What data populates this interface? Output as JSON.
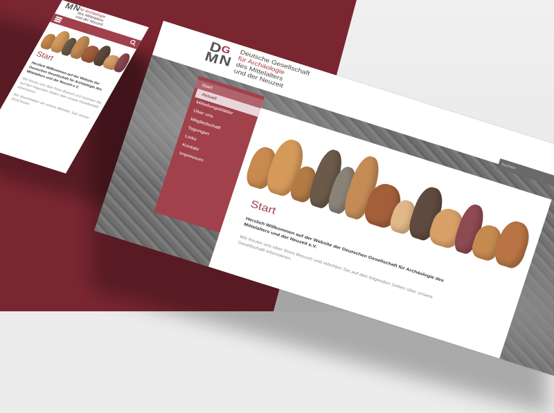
{
  "colors": {
    "brand": "#a0414c",
    "brand_dark": "#7a2631",
    "search_button": "#e6cfae"
  },
  "site": {
    "logo_letters": [
      "D",
      "G",
      "M",
      "N"
    ],
    "logo_lines": [
      "Deutsche Gesellschaft",
      "für Archäologie",
      "des Mittelalters",
      "und der Neuzeit"
    ]
  },
  "nav": {
    "items": [
      {
        "label": "Start",
        "active": true
      },
      {
        "label": "Aktuell",
        "sub": true
      },
      {
        "label": "Mitteilungsblätter"
      },
      {
        "label": "Über uns"
      },
      {
        "label": "Mitgliedschaft"
      },
      {
        "label": "Tagungen"
      },
      {
        "label": "Links"
      },
      {
        "label": "Kontakt"
      },
      {
        "label": "Impressum"
      }
    ]
  },
  "search": {
    "placeholder": "Suchen",
    "icon": "search-icon"
  },
  "page": {
    "title": "Start",
    "welcome": "Herzlich Willkommen auf der Website der Deutschen Gesellschaft für Archäologie des Mittelalters und der Neuzeit e.V.",
    "intro": "Wir freuen uns über Ihren Besuch und möchten Sie auf den folgenden Seiten über unsere Gesellschaft informieren."
  },
  "mobile": {
    "menu_icon": "hamburger-icon",
    "welcome": "Herzlich Willkommen auf der Website der Deutschen Gesellschaft für Archäologie des Mittelalters und der Neuzeit e.V.",
    "intro": "Wir freuen uns über Ihren Besuch und möchten Sie auf den folgenden Seiten über unsere Gesellschaft informieren.",
    "extra": "Wir überarbeiten wir unsere Website. Seit Januar 2018 finden"
  }
}
